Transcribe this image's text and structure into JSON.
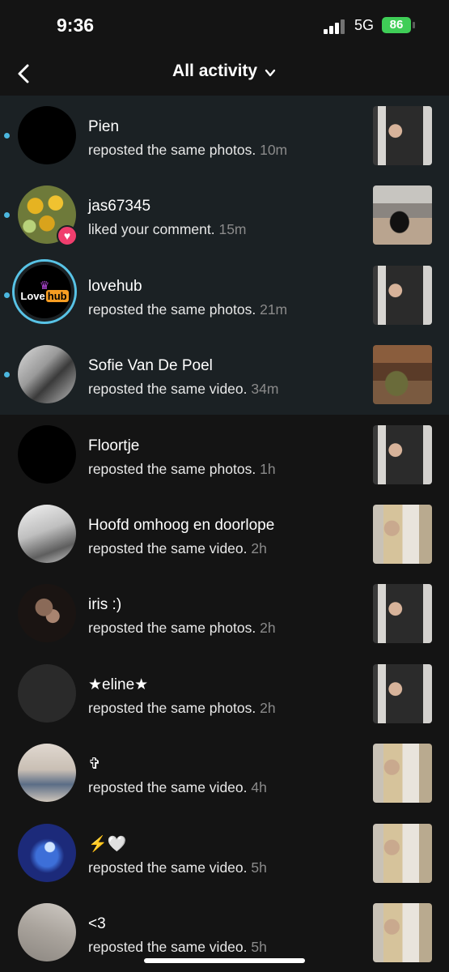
{
  "status": {
    "time": "9:36",
    "network": "5G",
    "battery": "86"
  },
  "nav": {
    "back_icon": "chevron-left-icon",
    "title": "All activity",
    "dropdown_icon": "chevron-down-icon"
  },
  "items": [
    {
      "name": "Pien",
      "action": "reposted the same photos.",
      "time": "10m",
      "unread": true
    },
    {
      "name": "jas67345",
      "action": "liked your comment.",
      "time": "15m",
      "unread": true,
      "badge": "heart-icon"
    },
    {
      "name": "lovehub",
      "action": "reposted the same photos.",
      "time": "21m",
      "unread": true,
      "avatar_logo": {
        "word1": "Love",
        "word2": "hub",
        "crown": "♛"
      }
    },
    {
      "name": "Sofie Van De Poel",
      "action": "reposted the same video.",
      "time": "34m",
      "unread": true
    },
    {
      "name": "Floortje",
      "action": "reposted the same photos.",
      "time": "1h",
      "unread": false
    },
    {
      "name": "Hoofd omhoog en doorlope",
      "action": "reposted the same video.",
      "time": "2h",
      "unread": false
    },
    {
      "name": "iris :)",
      "action": "reposted the same photos.",
      "time": "2h",
      "unread": false
    },
    {
      "name": "★eline★",
      "action": "reposted the same photos.",
      "time": "2h",
      "unread": false
    },
    {
      "name": "✞",
      "action": "reposted the same video.",
      "time": "4h",
      "unread": false
    },
    {
      "name": "⚡🤍",
      "action": "reposted the same video.",
      "time": "5h",
      "unread": false
    },
    {
      "name": "<3",
      "action": "reposted the same video.",
      "time": "5h",
      "unread": false
    }
  ],
  "colors": {
    "background": "#141414",
    "unread_background": "#1b2124",
    "unread_dot": "#4bb7df",
    "heart_badge": "#f03e6d",
    "battery": "#3fce57"
  }
}
